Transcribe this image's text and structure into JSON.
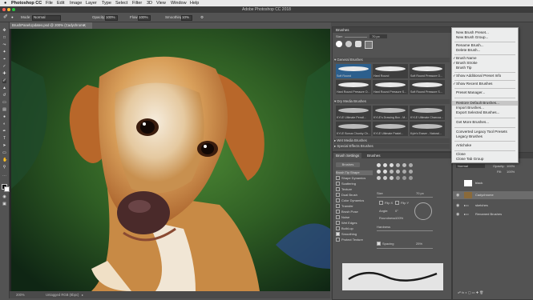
{
  "mac_menu": {
    "apple": "",
    "app": "Photoshop CC",
    "items": [
      "File",
      "Edit",
      "Image",
      "Layer",
      "Type",
      "Select",
      "Filter",
      "3D",
      "View",
      "Window",
      "Help"
    ]
  },
  "window": {
    "title": "Adobe Photoshop CC 2018"
  },
  "options_bar": {
    "mode_label": "Mode:",
    "mode_value": "Normal",
    "opacity_label": "Opacity:",
    "opacity_value": "100%",
    "flow_label": "Flow:",
    "flow_value": "100%",
    "smoothing_label": "Smoothing:",
    "smoothing_value": "10%"
  },
  "document": {
    "tab_title": "BrushPanelUpdates.psd @ 200% (Cadychrome, RGB/8#)",
    "zoom": "200%",
    "status": "Untagged RGB (8bpc)"
  },
  "brushes_panel": {
    "tab": "Brushes",
    "size_label": "Size:",
    "size_value": "70 px",
    "groups": [
      {
        "name": "General Brushes",
        "tiles": [
          "Soft Round",
          "Hard Round",
          "Soft Round Pressure O...",
          "Hard Round Pressure O...",
          "Hard Round Pressure S...",
          "Soft Round Pressure S..."
        ]
      },
      {
        "name": "Dry Media Brushes",
        "tiles": [
          "KYLE Ultimate Pencil...",
          "KYLE's Drawing Box - M...",
          "KYLE Ultimate Charcoa...",
          "KYLE Bonus Chunky Ch...",
          "KYLE Ultimate Pastel...",
          "Kyle's Eraser - Natural..."
        ]
      },
      {
        "name": "Wet Media Brushes",
        "tiles": []
      },
      {
        "name": "Special Effects Brushes",
        "tiles": []
      }
    ]
  },
  "brush_settings": {
    "tabs": [
      "Brush Settings",
      "Brushes"
    ],
    "brushes_btn": "Brushes",
    "options": [
      "Brush Tip Shape",
      "Shape Dynamics",
      "Scattering",
      "Texture",
      "Dual Brush",
      "Color Dynamics",
      "Transfer",
      "Brush Pose",
      "Noise",
      "Wet Edges",
      "Build-up",
      "Smoothing",
      "Protect Texture"
    ],
    "size_label": "Size",
    "size_value": "70 px",
    "flip_x": "Flip X",
    "flip_y": "Flip Y",
    "angle_label": "Angle:",
    "angle_value": "0°",
    "roundness_label": "Roundness:",
    "roundness_value": "100%",
    "hardness_label": "Hardness",
    "spacing_label": "Spacing",
    "spacing_value": "25%"
  },
  "layers": {
    "blend_mode": "Normal",
    "opacity_label": "Opacity:",
    "opacity_value": "100%",
    "fill_label": "Fill:",
    "fill_value": "100%",
    "items": [
      {
        "name": "black",
        "selected": false
      },
      {
        "name": "Cadychrome",
        "selected": true
      },
      {
        "name": "sketches",
        "selected": false
      },
      {
        "name": "Renamed Brushes",
        "selected": false
      }
    ]
  },
  "flyout_menu": {
    "items": [
      {
        "label": "New Brush Preset...",
        "checked": false,
        "highlighted": false
      },
      {
        "label": "New Brush Group...",
        "checked": false,
        "highlighted": false
      },
      {
        "label": "Rename Brush...",
        "checked": false,
        "highlighted": false
      },
      {
        "label": "Delete Brush...",
        "checked": false,
        "highlighted": false
      },
      {
        "label": "Brush Name",
        "checked": true,
        "highlighted": false
      },
      {
        "label": "Brush Stroke",
        "checked": true,
        "highlighted": false
      },
      {
        "label": "Brush Tip",
        "checked": false,
        "highlighted": false
      },
      {
        "label": "Show Additional Preset Info",
        "checked": true,
        "highlighted": false
      },
      {
        "label": "Show Recent Brushes",
        "checked": true,
        "highlighted": false
      },
      {
        "label": "Preset Manager...",
        "checked": false,
        "highlighted": false
      },
      {
        "label": "Restore Default Brushes...",
        "checked": false,
        "highlighted": true
      },
      {
        "label": "Import Brushes...",
        "checked": false,
        "highlighted": false
      },
      {
        "label": "Export Selected Brushes...",
        "checked": false,
        "highlighted": false
      },
      {
        "label": "Get More Brushes...",
        "checked": false,
        "highlighted": false
      },
      {
        "label": "Converted Legacy Tool Presets",
        "checked": false,
        "highlighted": false
      },
      {
        "label": "Legacy Brushes",
        "checked": false,
        "highlighted": false
      },
      {
        "label": "Artichoke",
        "checked": false,
        "highlighted": false
      },
      {
        "label": "Close",
        "checked": false,
        "highlighted": false
      },
      {
        "label": "Close Tab Group",
        "checked": false,
        "highlighted": false
      }
    ]
  },
  "colors": {
    "selection_blue": "#2c5f8d",
    "menu_bg": "#eceded",
    "panel_bg": "#535353"
  }
}
